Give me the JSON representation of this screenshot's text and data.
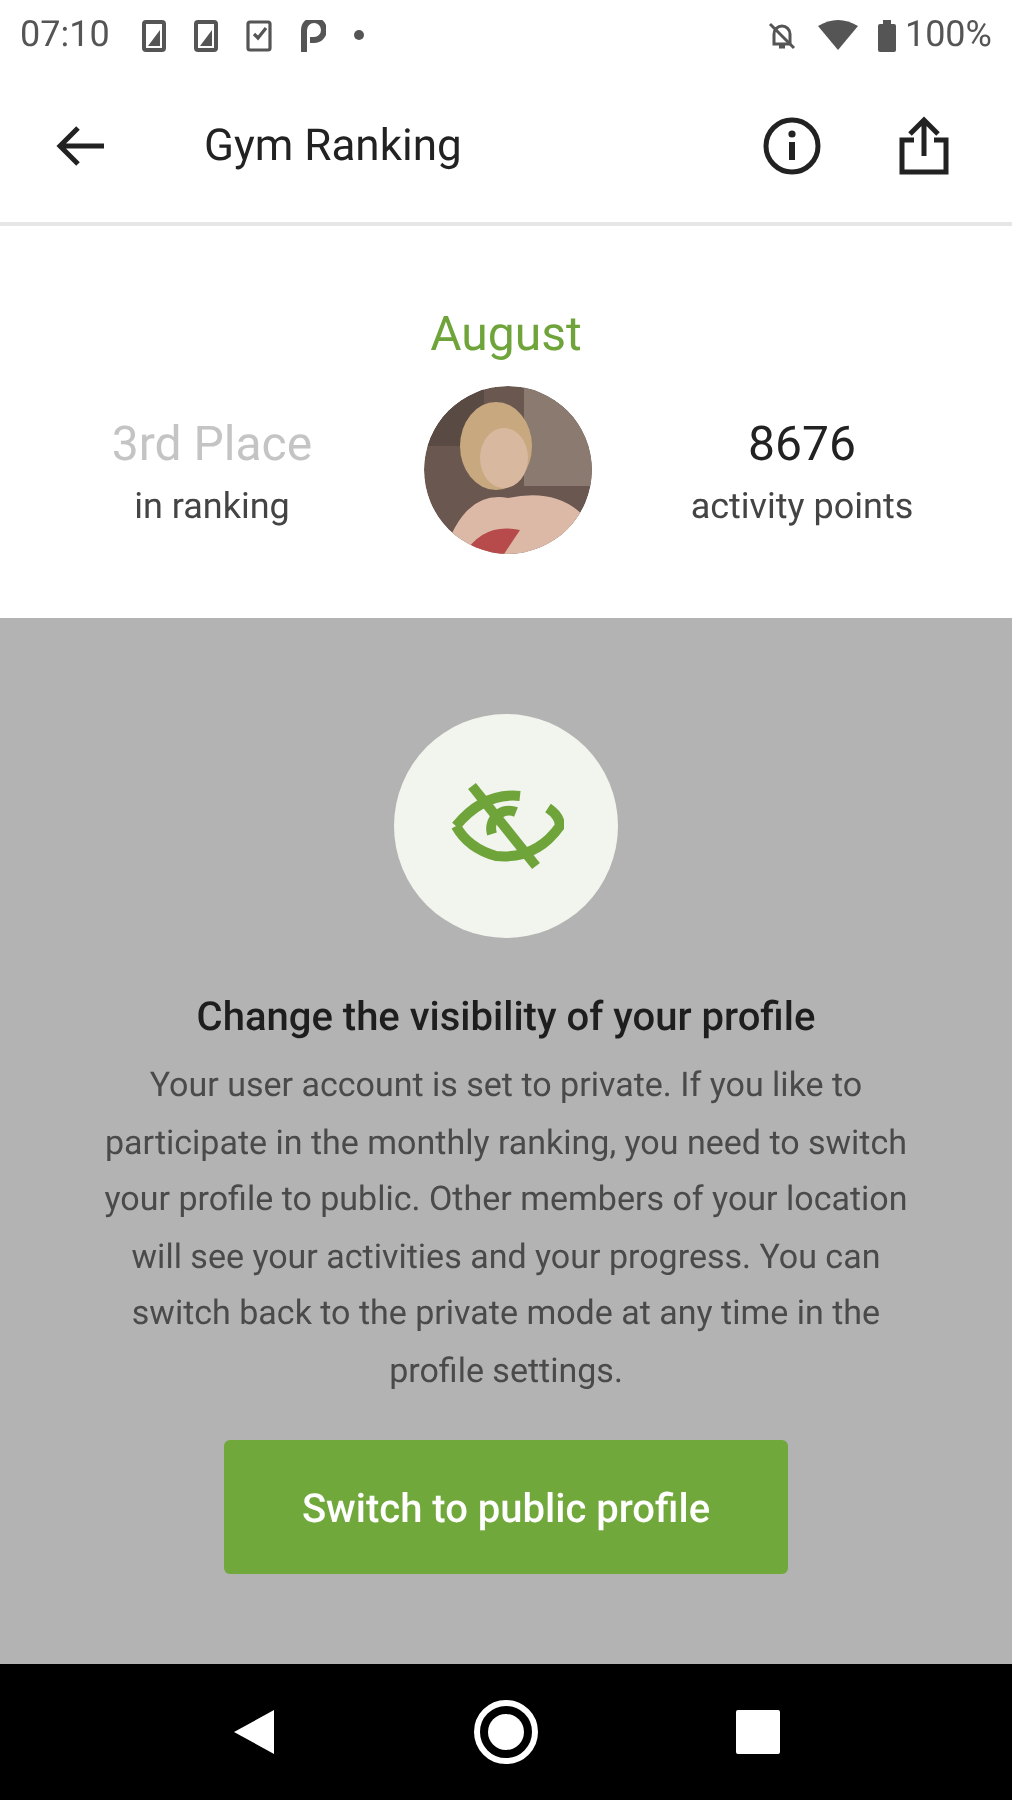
{
  "status_bar": {
    "time": "07:10",
    "battery": "100%"
  },
  "app_bar": {
    "title": "Gym Ranking"
  },
  "summary": {
    "month": "August",
    "rank": "3rd Place",
    "rank_label": "in ranking",
    "points": "8676",
    "points_label": "activity points"
  },
  "dialog": {
    "title": "Change the visibility of your profile",
    "message": "Your user account is set to private. If you like to participate in the monthly ranking, you need to switch your profile to public. Other members of your location will see your activities and your progress. You can switch back to the private mode at any time in the profile settings.",
    "button": "Switch to public profile"
  }
}
